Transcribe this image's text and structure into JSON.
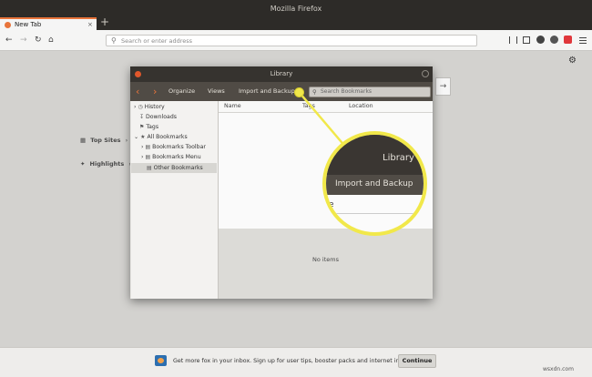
{
  "window": {
    "title": "Mozilla Firefox"
  },
  "tab": {
    "label": "New Tab",
    "close": "×",
    "new_tab": "+"
  },
  "nav": {
    "back": "←",
    "forward": "→",
    "reload": "↻",
    "home": "⌂",
    "url_placeholder": "Search or enter address"
  },
  "newtab_page": {
    "top_sites": "Top Sites",
    "highlights": "Highlights",
    "gear": "⚙",
    "expand": "›",
    "go_arrow": "→"
  },
  "library": {
    "title": "Library",
    "toolbar": {
      "organize": "Organize",
      "views": "Views",
      "import_backup": "Import and Backup",
      "search_placeholder": "Search Bookmarks"
    },
    "tree": [
      {
        "label": "History",
        "arrow": "›"
      },
      {
        "label": "Downloads",
        "arrow": ""
      },
      {
        "label": "Tags",
        "arrow": ""
      },
      {
        "label": "All Bookmarks",
        "arrow": "⌄"
      },
      {
        "label": "Bookmarks Toolbar",
        "arrow": "›"
      },
      {
        "label": "Bookmarks Menu",
        "arrow": "›"
      },
      {
        "label": "Other Bookmarks",
        "arrow": ""
      }
    ],
    "columns": {
      "name": "Name",
      "tags": "Tags",
      "location": "Location"
    },
    "no_items": "No items"
  },
  "zoom": {
    "library": "Library",
    "import_backup": "Import and Backup",
    "name_fragment": "e"
  },
  "banner": {
    "text": "Get more fox in your inbox. Sign up for user tips, booster packs and internet intel.",
    "button": "Continue"
  },
  "watermark": "wsxdn.com",
  "colors": {
    "accent": "#e8743b",
    "highlight": "#f1e84a"
  }
}
